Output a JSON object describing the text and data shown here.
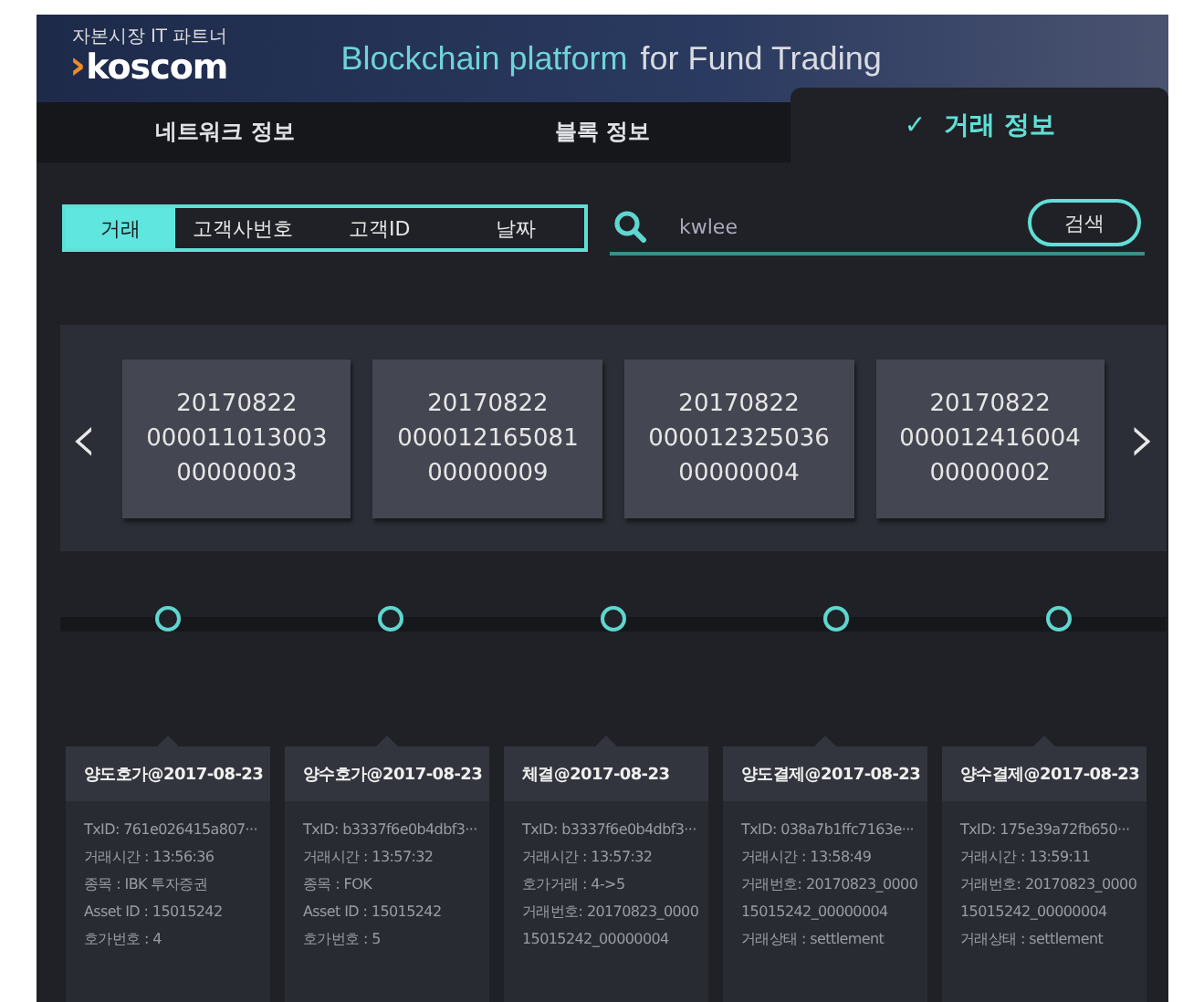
{
  "header": {
    "logo_tagline": "자본시장 IT 파트너",
    "logo_mark": "›",
    "logo_text": "koscom",
    "title_accent": "Blockchain platform",
    "title_rest": "for Fund Trading"
  },
  "tabs": [
    {
      "label": "네트워크 정보",
      "selected": false
    },
    {
      "label": "블록 정보",
      "selected": false
    },
    {
      "label": "거래 정보",
      "selected": true,
      "check": "✓"
    }
  ],
  "filters": [
    {
      "label": "거래",
      "selected": true
    },
    {
      "label": "고객사번호",
      "selected": false
    },
    {
      "label": "고객ID",
      "selected": false
    },
    {
      "label": "날짜",
      "selected": false
    }
  ],
  "search": {
    "value": "kwlee",
    "button": "검색"
  },
  "blocks": {
    "prev": "‹",
    "next": "›",
    "items": [
      {
        "lines": [
          "20170822",
          "000011013003",
          "00000003"
        ]
      },
      {
        "lines": [
          "20170822",
          "000012165081",
          "00000009"
        ]
      },
      {
        "lines": [
          "20170822",
          "000012325036",
          "00000004"
        ]
      },
      {
        "lines": [
          "20170822",
          "000012416004",
          "00000002"
        ]
      }
    ]
  },
  "transactions": [
    {
      "title": "양도호가@2017-08-23",
      "lines": [
        "TxID: 761e026415a807···",
        "거래시간 : 13:56:36",
        "종목 : IBK 투자증권",
        "Asset ID : 15015242",
        "호가번호 : 4"
      ]
    },
    {
      "title": "양수호가@2017-08-23",
      "lines": [
        "TxID: b3337f6e0b4dbf3···",
        "거래시간 : 13:57:32",
        "종목 : FOK",
        "Asset ID : 15015242",
        "호가번호 : 5"
      ]
    },
    {
      "title": "체결@2017-08-23",
      "lines": [
        "TxID: b3337f6e0b4dbf3···",
        "거래시간 : 13:57:32",
        "호가거래 : 4->5",
        "거래번호: 20170823_0000",
        "15015242_00000004"
      ]
    },
    {
      "title": "양도결제@2017-08-23",
      "lines": [
        "TxID: 038a7b1ffc7163e···",
        "거래시간 : 13:58:49",
        "거래번호: 20170823_0000",
        "15015242_00000004",
        "거래상태 : settlement"
      ]
    },
    {
      "title": "양수결제@2017-08-23",
      "lines": [
        "TxID: 175e39a72fb650···",
        "거래시간 : 13:59:11",
        "거래번호: 20170823_0000",
        "15015242_00000004",
        "거래상태 : settlement"
      ]
    }
  ]
}
